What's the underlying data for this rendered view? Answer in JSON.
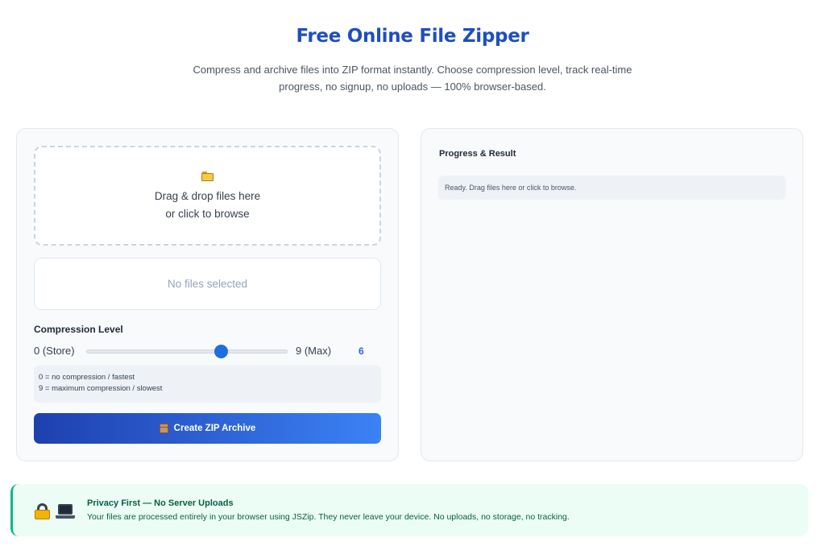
{
  "header": {
    "title": "Free Online File Zipper",
    "subtitle": "Compress and archive files into ZIP format instantly. Choose compression level, track real-time progress, no signup, no uploads — 100% browser-based."
  },
  "left_panel": {
    "dropzone": {
      "icon": "folder-icon",
      "line1": "Drag & drop files here",
      "line2": "or click to browse"
    },
    "file_list": {
      "empty_text": "No files selected"
    },
    "compression": {
      "label": "Compression Level",
      "min_label": "0 (Store)",
      "max_label": "9 (Max)",
      "min": 0,
      "max": 9,
      "value": 6,
      "value_text": "6",
      "hint_lines": [
        "0 = no compression / fastest",
        "9 = maximum compression / slowest"
      ]
    },
    "create_button": {
      "icon": "box-icon",
      "label": "Create ZIP Archive"
    }
  },
  "right_panel": {
    "title": "Progress & Result",
    "status": "Ready. Drag files here or click to browse."
  },
  "privacy": {
    "icons": [
      "lock-icon",
      "laptop-icon"
    ],
    "title": "Privacy First — No Server Uploads",
    "text": "Your files are processed entirely in your browser using JSZip. They never leave your device. No uploads, no storage, no tracking."
  },
  "colors": {
    "title": "#1e4fc0",
    "accent": "#2563eb",
    "button_start": "#1e40af",
    "button_end": "#3b82f6",
    "privacy_bg": "#ecfdf5",
    "privacy_border": "#10b981"
  }
}
